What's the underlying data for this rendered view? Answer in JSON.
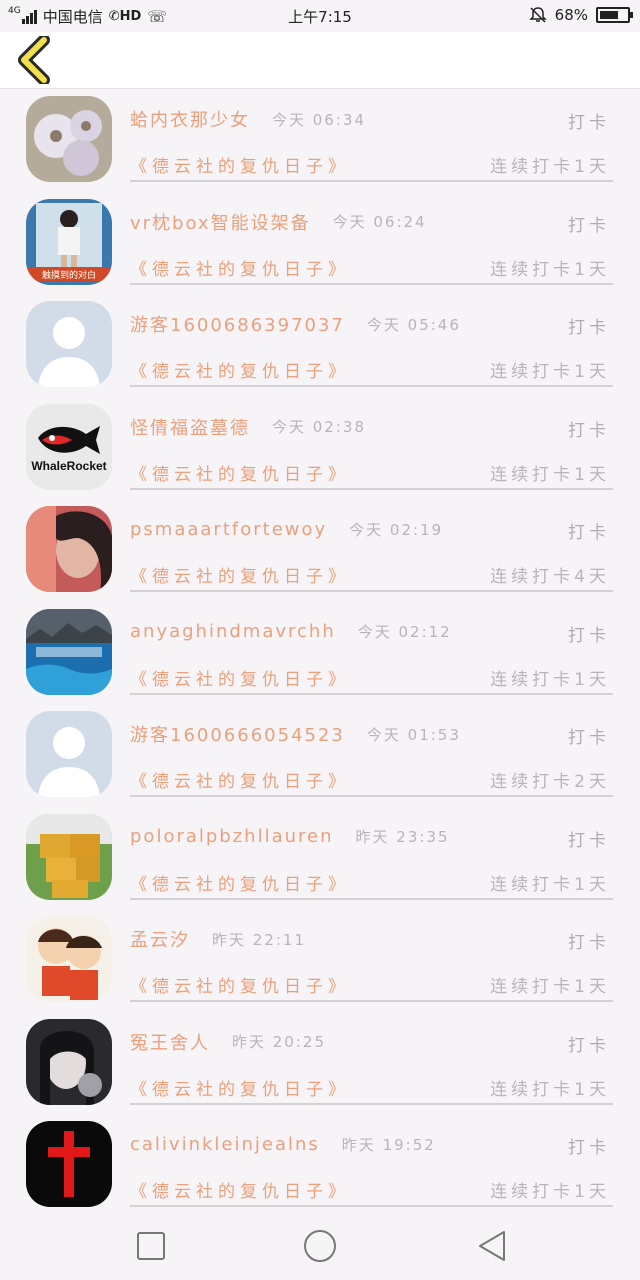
{
  "status_bar": {
    "signal": "4G",
    "carrier": "中国电信",
    "hd": "HD",
    "time": "上午7:15",
    "battery": "68%",
    "battery_level": 0.68,
    "icons": [
      "signal-icon",
      "hd-call-icon",
      "wifi-call-icon",
      "mute-bell-icon",
      "battery-icon"
    ]
  },
  "header": {
    "back_icon": "chevron-left-icon",
    "accent": "#f4e04d"
  },
  "colors": {
    "name": "#eaa07c",
    "muted": "#b8b4b8",
    "bg": "#f6f4f6"
  },
  "rows": [
    {
      "name": "蛤内衣那少女",
      "time": "今天 06:34",
      "checkin": "打卡",
      "book": "《德云社的复仇日子》",
      "streak": "连续打卡1天",
      "avatar": "flowers-avatar"
    },
    {
      "name": "vr枕box智能设架备",
      "time": "今天 06:24",
      "checkin": "打卡",
      "book": "《德云社的复仇日子》",
      "streak": "连续打卡1天",
      "avatar": "girl-poster-avatar"
    },
    {
      "name": "游客1600686397037",
      "time": "今天 05:46",
      "checkin": "打卡",
      "book": "《德云社的复仇日子》",
      "streak": "连续打卡1天",
      "avatar": "default-person-avatar"
    },
    {
      "name": "怪倩福盗墓德",
      "time": "今天 02:38",
      "checkin": "打卡",
      "book": "《德云社的复仇日子》",
      "streak": "连续打卡1天",
      "avatar": "whalerocket-logo-avatar",
      "avatar_text": "WhaleRocket"
    },
    {
      "name": "psmaaartfortewoy",
      "time": "今天 02:19",
      "checkin": "打卡",
      "book": "《德云社的复仇日子》",
      "streak": "连续打卡4天",
      "avatar": "selfie-avatar"
    },
    {
      "name": "anyaghindmavrchh",
      "time": "今天 02:12",
      "checkin": "打卡",
      "book": "《德云社的复仇日子》",
      "streak": "连续打卡1天",
      "avatar": "ocean-avatar"
    },
    {
      "name": "游客1600666054523",
      "time": "今天 01:53",
      "checkin": "打卡",
      "book": "《德云社的复仇日子》",
      "streak": "连续打卡2天",
      "avatar": "default-person-avatar"
    },
    {
      "name": "poloralpbzhllauren",
      "time": "昨天 23:35",
      "checkin": "打卡",
      "book": "《德云社的复仇日子》",
      "streak": "连续打卡1天",
      "avatar": "cake-avatar"
    },
    {
      "name": "孟云汐",
      "time": "昨天 22:11",
      "checkin": "打卡",
      "book": "《德云社的复仇日子》",
      "streak": "连续打卡1天",
      "avatar": "cartoon-couple-avatar"
    },
    {
      "name": "冤王舍人",
      "time": "昨天 20:25",
      "checkin": "打卡",
      "book": "《德云社的复仇日子》",
      "streak": "连续打卡1天",
      "avatar": "dark-girl-avatar"
    },
    {
      "name": "calivinkleinjealns",
      "time": "昨天 19:52",
      "checkin": "打卡",
      "book": "《德云社的复仇日子》",
      "streak": "连续打卡1天",
      "avatar": "red-cross-avatar"
    }
  ],
  "nav": {
    "icons": [
      "recent-apps-icon",
      "home-icon",
      "back-icon"
    ]
  }
}
